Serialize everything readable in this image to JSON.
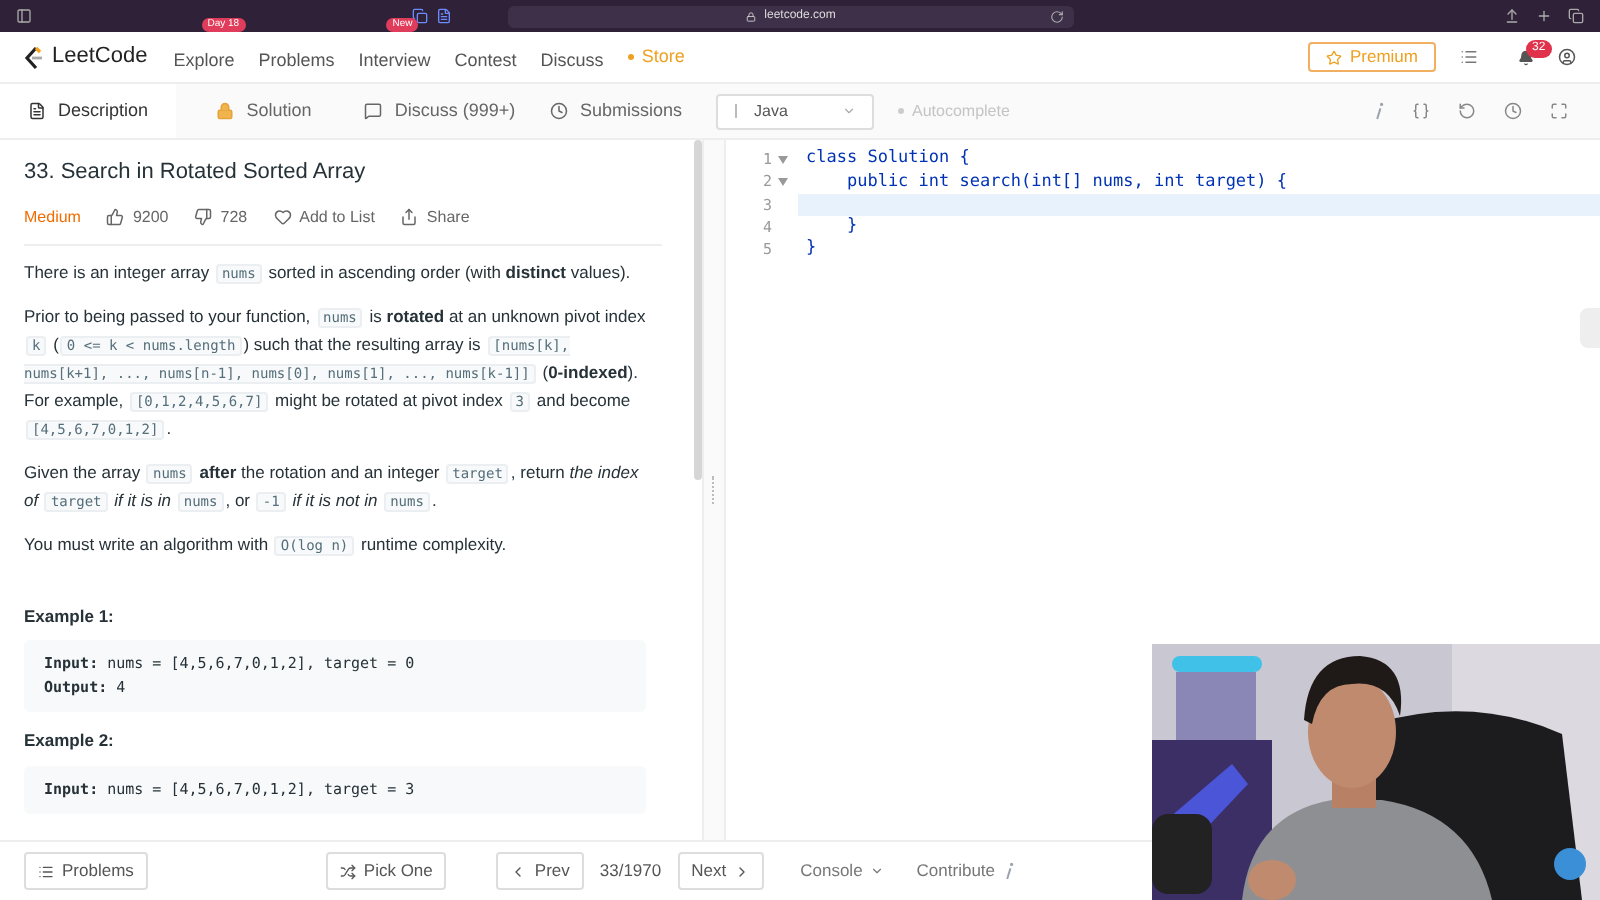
{
  "browser": {
    "url": "leetcode.com"
  },
  "nav": {
    "logo": "LeetCode",
    "items": [
      {
        "label": "Explore",
        "kind": "link",
        "badge": "Day 18"
      },
      {
        "label": "Problems",
        "kind": "link"
      },
      {
        "label": "Interview",
        "kind": "link",
        "badge": "New"
      },
      {
        "label": "Contest",
        "kind": "link"
      },
      {
        "label": "Discuss",
        "kind": "link"
      },
      {
        "label": "Store",
        "kind": "store"
      }
    ],
    "premium": "Premium",
    "notification_count": "32"
  },
  "tabs": [
    {
      "label": "Description",
      "kind": "description",
      "selected": true
    },
    {
      "label": "Solution",
      "kind": "solution",
      "selected": false
    },
    {
      "label": "Discuss (999+)",
      "kind": "discuss",
      "selected": false
    },
    {
      "label": "Submissions",
      "kind": "submissions",
      "selected": false
    }
  ],
  "editor_toolbar": {
    "language": "Java",
    "autocomplete": "Autocomplete"
  },
  "problem": {
    "title": "33. Search in Rotated Sorted Array",
    "difficulty": "Medium",
    "likes": "9200",
    "dislikes": "728",
    "add_to_list": "Add to List",
    "share": "Share",
    "paragraphs": [
      [
        {
          "kind": "text",
          "text": "There is an integer array "
        },
        {
          "kind": "code",
          "text": "nums"
        },
        {
          "kind": "text",
          "text": " sorted in ascending order (with **distinct** values)."
        }
      ],
      [
        {
          "kind": "text",
          "text": "Prior to being passed to your function, "
        },
        {
          "kind": "code",
          "text": "nums"
        },
        {
          "kind": "text",
          "text": " is **rotated** at an unknown pivot index "
        },
        {
          "kind": "code",
          "text": "k"
        },
        {
          "kind": "text",
          "text": " ("
        },
        {
          "kind": "code",
          "text": "0 <= k < nums.length"
        },
        {
          "kind": "text",
          "text": ") such that the resulting array is "
        },
        {
          "kind": "code",
          "text": "[nums[k], nums[k+1], ..., nums[n-1], nums[0], nums[1], ..., nums[k-1]]"
        },
        {
          "kind": "text",
          "text": " (**0-indexed**). For example, "
        },
        {
          "kind": "code",
          "text": "[0,1,2,4,5,6,7]"
        },
        {
          "kind": "text",
          "text": " might be rotated at pivot index "
        },
        {
          "kind": "code",
          "text": "3"
        },
        {
          "kind": "text",
          "text": " and become "
        },
        {
          "kind": "code",
          "text": "[4,5,6,7,0,1,2]"
        },
        {
          "kind": "text",
          "text": "."
        }
      ],
      [
        {
          "kind": "text",
          "text": "Given the array "
        },
        {
          "kind": "code",
          "text": "nums"
        },
        {
          "kind": "text",
          "text": " **after** the rotation and an integer "
        },
        {
          "kind": "code",
          "text": "target"
        },
        {
          "kind": "text",
          "text": ", return *the index of* "
        },
        {
          "kind": "code",
          "text": "target"
        },
        {
          "kind": "text",
          "text": " *if it is in* "
        },
        {
          "kind": "code",
          "text": "nums"
        },
        {
          "kind": "text",
          "text": ", or "
        },
        {
          "kind": "code",
          "text": "-1"
        },
        {
          "kind": "text",
          "text": " *if it is not in* "
        },
        {
          "kind": "code",
          "text": "nums"
        },
        {
          "kind": "text",
          "text": "."
        }
      ],
      [
        {
          "kind": "text",
          "text": "You must write an algorithm with "
        },
        {
          "kind": "code",
          "text": "O(log n)"
        },
        {
          "kind": "text",
          "text": " runtime complexity."
        }
      ]
    ],
    "examples": [
      {
        "heading": "Example 1:",
        "lines": [
          {
            "label": "Input:",
            "value": "nums = [4,5,6,7,0,1,2], target = 0"
          },
          {
            "label": "Output:",
            "value": "4"
          }
        ]
      },
      {
        "heading": "Example 2:",
        "lines": [
          {
            "label": "Input:",
            "value": "nums = [4,5,6,7,0,1,2], target = 3"
          }
        ]
      }
    ]
  },
  "code": {
    "lines": [
      {
        "number": "1",
        "text": "class Solution {",
        "foldable": true,
        "highlighted": false
      },
      {
        "number": "2",
        "text": "    public int search(int[] nums, int target) {",
        "foldable": true,
        "highlighted": false
      },
      {
        "number": "3",
        "foldable": false,
        "highlighted": true
      },
      {
        "number": "4",
        "text": "    }",
        "foldable": false,
        "highlighted": false
      },
      {
        "number": "5",
        "text": "}",
        "foldable": false,
        "highlighted": false
      }
    ]
  },
  "bottom_bar": {
    "problems": "Problems",
    "pick_one": "Pick One",
    "prev": "Prev",
    "counter": "33/1970",
    "next": "Next",
    "console": "Console",
    "contribute": "Contribute"
  }
}
